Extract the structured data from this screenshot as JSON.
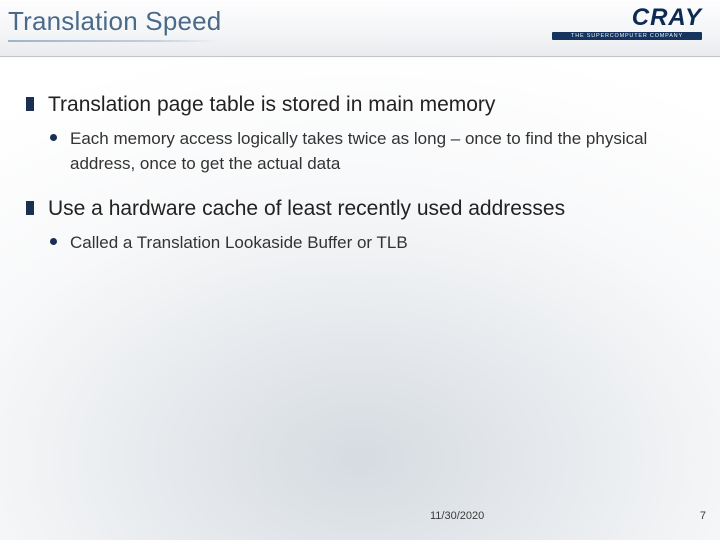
{
  "header": {
    "title": "Translation Speed",
    "logo": {
      "name": "CRAY",
      "tagline": "THE SUPERCOMPUTER COMPANY"
    }
  },
  "bullets": [
    {
      "text": "Translation page table is stored in main memory",
      "children": [
        {
          "text": "Each memory access logically takes twice as long – once to find the physical address, once to get the actual data"
        }
      ]
    },
    {
      "text": "Use a hardware cache of least recently used addresses",
      "children": [
        {
          "text": "Called a Translation Lookaside Buffer or TLB"
        }
      ]
    }
  ],
  "footer": {
    "date": "11/30/2020",
    "page": "7"
  }
}
